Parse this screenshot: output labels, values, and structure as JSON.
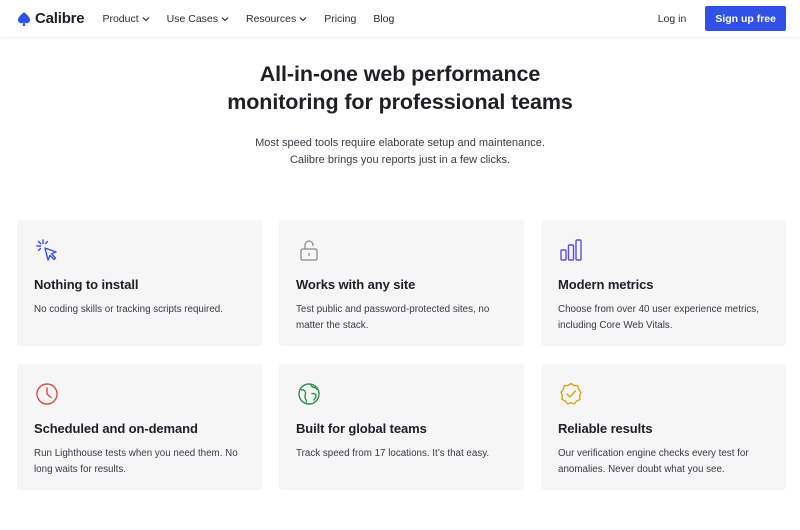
{
  "nav": {
    "brand": "Calibre",
    "brand_color": "#3150e6",
    "items": [
      {
        "label": "Product",
        "dropdown": true
      },
      {
        "label": "Use Cases",
        "dropdown": true
      },
      {
        "label": "Resources",
        "dropdown": true
      },
      {
        "label": "Pricing",
        "dropdown": false
      },
      {
        "label": "Blog",
        "dropdown": false
      }
    ],
    "login": "Log in",
    "signup": "Sign up free"
  },
  "hero": {
    "title_line1": "All-in-one web performance",
    "title_line2": "monitoring for professional teams",
    "sub_line1": "Most speed tools require elaborate setup and maintenance.",
    "sub_line2": "Calibre brings you reports just in a few clicks."
  },
  "features": [
    {
      "icon": "cursor-click-icon",
      "color": "#3150e6",
      "title": "Nothing to install",
      "desc": "No coding skills or tracking scripts required."
    },
    {
      "icon": "unlock-icon",
      "color": "#8a8a90",
      "title": "Works with any site",
      "desc": "Test public and password-protected sites, no matter the stack."
    },
    {
      "icon": "bar-chart-icon",
      "color": "#5b4fe0",
      "title": "Modern metrics",
      "desc": "Choose from over 40 user experience metrics, including Core Web Vitals."
    },
    {
      "icon": "clock-icon",
      "color": "#e04b3c",
      "title": "Scheduled and on-demand",
      "desc": "Run Lighthouse tests when you need them. No long waits for results."
    },
    {
      "icon": "globe-icon",
      "color": "#2f8f4e",
      "title": "Built for global teams",
      "desc": "Track speed from 17 locations. It’s that easy."
    },
    {
      "icon": "verified-badge-icon",
      "color": "#d9a21b",
      "title": "Reliable results",
      "desc": "Our verification engine checks every test for anomalies. Never doubt what you see."
    }
  ]
}
